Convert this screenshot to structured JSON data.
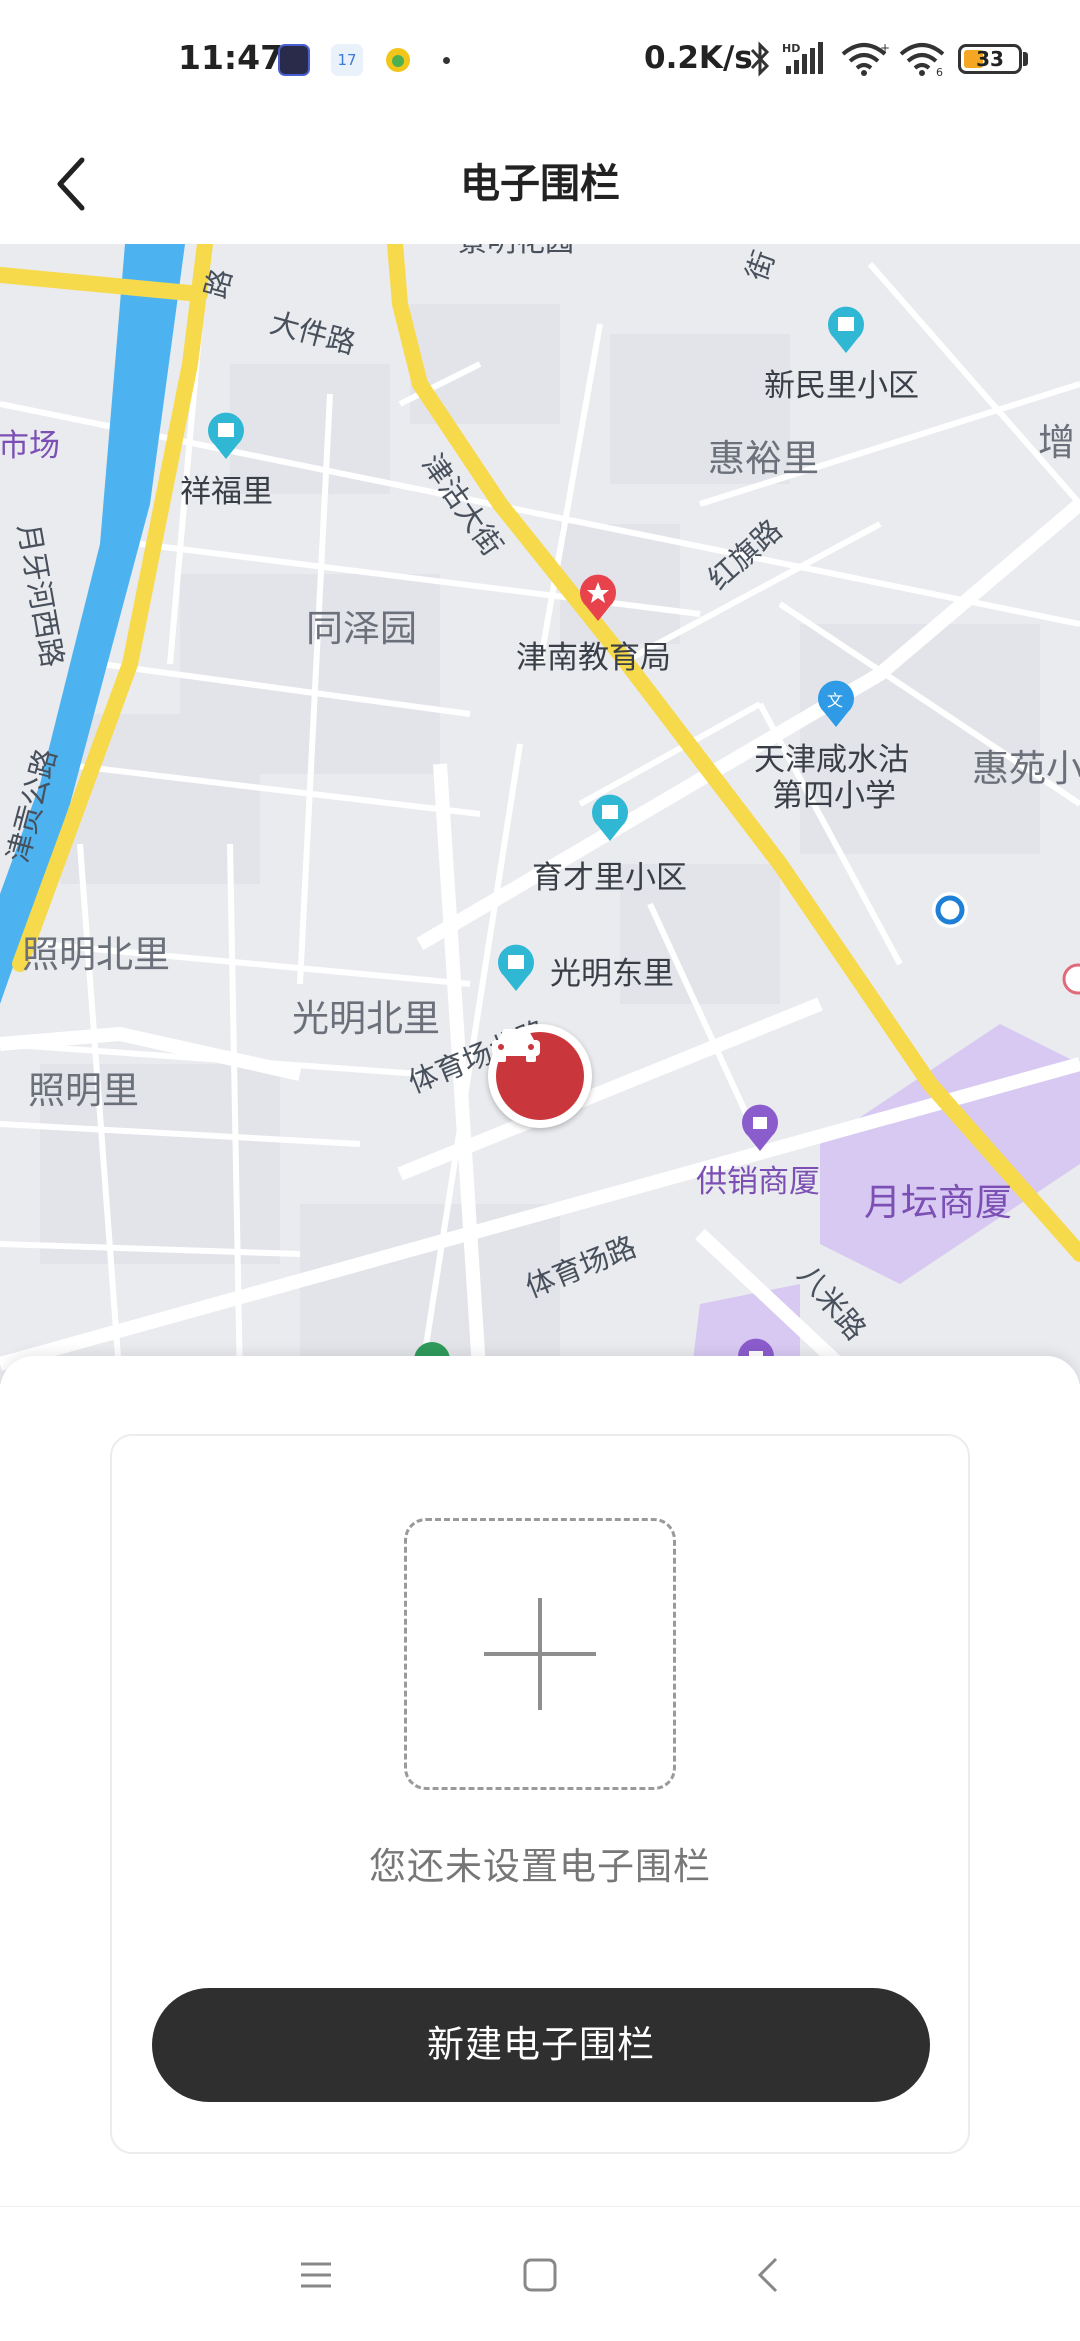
{
  "status_bar": {
    "time": "11:47",
    "net_speed": "0.2K/s",
    "battery": "33",
    "icons": [
      "app-icon-1",
      "calendar-icon",
      "app-icon-3",
      "notification-dot",
      "bluetooth-icon",
      "signal-icon",
      "wifi-icon",
      "hotspot-icon",
      "battery-icon"
    ]
  },
  "header": {
    "title": "电子围栏",
    "back_icon": "chevron-left-icon"
  },
  "map": {
    "labels": {
      "dajian_rd": "大件路",
      "lu_top": "路",
      "jinguhang": "津沽大街",
      "xinminli": "新民里小区",
      "huiyuli": "惠裕里",
      "zeng": "增",
      "shichang": "市场",
      "xiangfuli": "祥福里",
      "yueyahexi": "月牙河西路",
      "hongqi": "红旗路",
      "tongzeyuan": "同泽园",
      "jinnan_edu": "津南教育局",
      "xianshuigu": "天津咸水沽",
      "xianshuigu2": "第四小学",
      "huiyuan": "惠苑小",
      "jingong": "津贡公路",
      "yucaili": "育才里小区",
      "zhaomingbeili": "照明北里",
      "guangmingdongli": "光明东里",
      "guangmingbeili": "光明北里",
      "tiyuchang_n": "体育场北路",
      "zhaomingli": "照明里",
      "gongxiao": "供销商厦",
      "yuetan": "月坛商厦",
      "tiyuchang": "体育场路",
      "bami": "八米路",
      "top_partial": "景明花园",
      "jie": "街"
    }
  },
  "fence": {
    "empty_message": "您还未设置电子围栏",
    "create_button": "新建电子围栏"
  },
  "navbar": {
    "icons": [
      "menu-icon",
      "home-icon",
      "back-icon"
    ]
  }
}
